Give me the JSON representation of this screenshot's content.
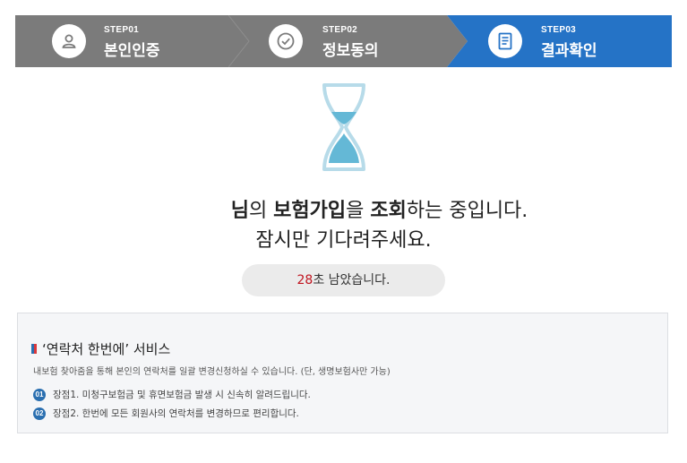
{
  "steps": [
    {
      "no": "STEP01",
      "title": "본인인증",
      "icon": "user-icon"
    },
    {
      "no": "STEP02",
      "title": "정보동의",
      "icon": "check-circle-icon"
    },
    {
      "no": "STEP03",
      "title": "결과확인",
      "icon": "document-icon"
    }
  ],
  "colors": {
    "step_done": "#7b7b7b",
    "step_active": "#2573c6",
    "timer_seconds": "#c0141f",
    "number_badge": "#2a6fb0"
  },
  "status": {
    "name_suffix": "님",
    "part1": "의 ",
    "keyword1": "보험가입",
    "part2": "을 ",
    "keyword2": "조회",
    "part3": "하는 중입니다.",
    "line2": "잠시만 기다려주세요."
  },
  "timer": {
    "seconds": "28",
    "unit_text": "초 남았습니다."
  },
  "notice": {
    "title": "‘연락처 한번에’ 서비스",
    "description": "내보험 찾아줌을 통해 본인의 연락처를 일괄 변경신청하실 수 있습니다. (단, 생명보험사만 가능)",
    "items": [
      {
        "num": "01",
        "text": "장점1. 미청구보험금 및 휴면보험금 발생 시 신속히 알려드립니다."
      },
      {
        "num": "02",
        "text": "장점2. 한번에 모든 회원사의 연락처를 변경하므로 편리합니다."
      }
    ]
  }
}
